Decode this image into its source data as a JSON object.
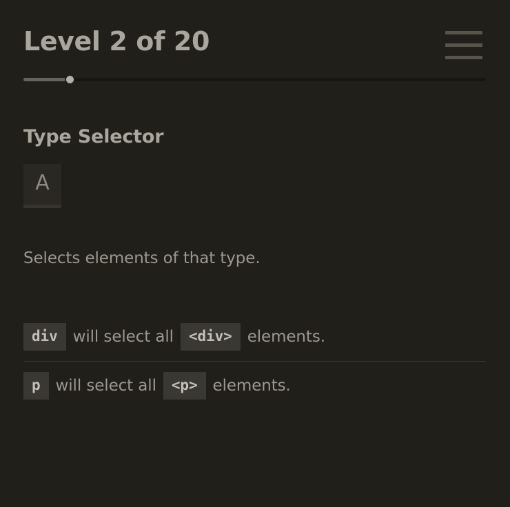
{
  "header": {
    "level_title": "Level 2 of 20",
    "menu_icon": "hamburger-menu-icon"
  },
  "progress": {
    "current_level": 2,
    "total_levels": 20,
    "percent": 10,
    "fill_color": "#67645c",
    "track_color": "#17160f",
    "knob_color": "#b3b0a6"
  },
  "lesson": {
    "selector_name": "Type Selector",
    "glyph": "A",
    "description": "Selects elements of that type.",
    "examples": [
      {
        "selector": "div",
        "middle_text": "will select all",
        "element": "<div>",
        "suffix_text": "elements."
      },
      {
        "selector": "p",
        "middle_text": "will select all",
        "element": "<p>",
        "suffix_text": "elements."
      }
    ]
  },
  "colors": {
    "background": "#211F19",
    "text_primary": "#a9a69d",
    "text_secondary": "#9b988f",
    "chip_background": "#3a3833",
    "chip_text": "#c3c0b6",
    "glyph_box_background": "#2a2822",
    "divider": "#3a3832"
  }
}
